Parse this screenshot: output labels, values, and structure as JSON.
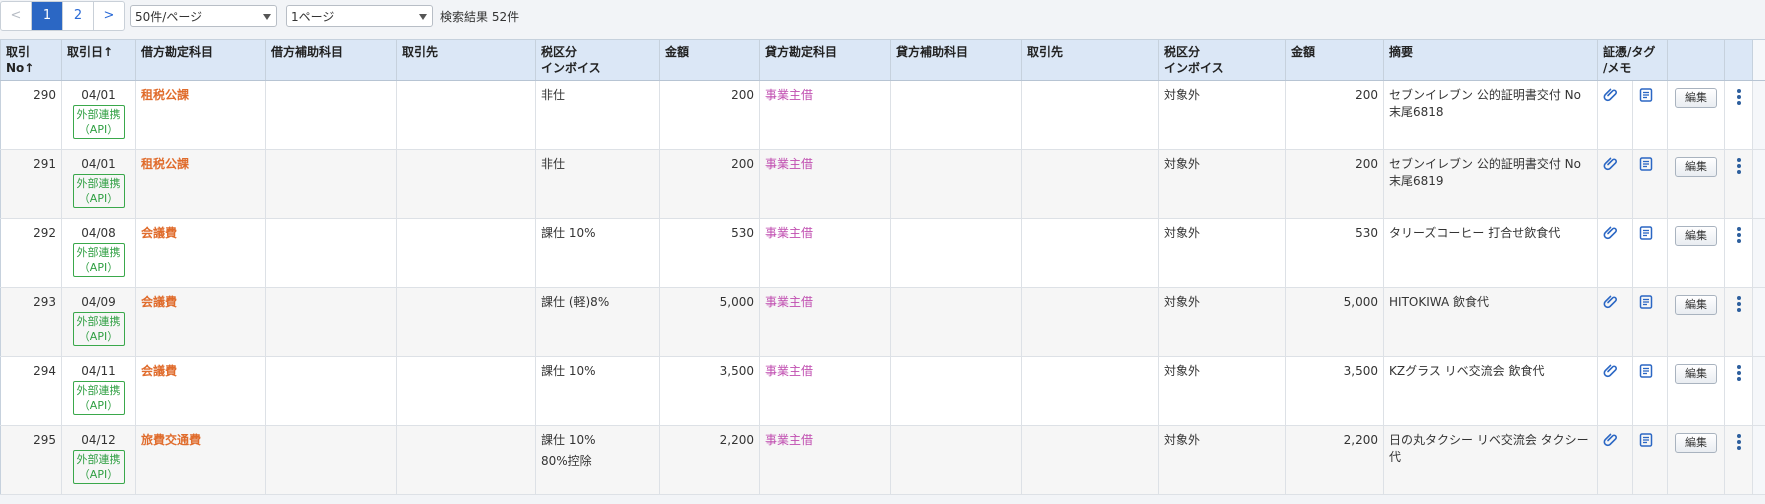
{
  "pagination": {
    "prev": "<",
    "pages": [
      "1",
      "2"
    ],
    "active_page": "1",
    "next": ">",
    "per_page": "50件/ページ",
    "page_select": "1ページ",
    "result_count": "検索結果 52件"
  },
  "headers": {
    "txn_no": "取引No↑",
    "txn_date": "取引日↑",
    "debit_account": "借方勘定科目",
    "debit_sub": "借方補助科目",
    "debit_partner": "取引先",
    "debit_tax_1": "税区分",
    "debit_tax_2": "インボイス",
    "debit_amount": "金額",
    "credit_account": "貸方勘定科目",
    "credit_sub": "貸方補助科目",
    "credit_partner": "取引先",
    "credit_tax_1": "税区分",
    "credit_tax_2": "インボイス",
    "credit_amount": "金額",
    "summary": "摘要",
    "evidence_1": "証憑/タグ",
    "evidence_2": "/メモ"
  },
  "edit_label": "編集",
  "api_tag_line1": "外部連携",
  "api_tag_line2": "（API）",
  "rows": [
    {
      "no": "290",
      "date": "04/01",
      "debit_account": "租税公課",
      "debit_tax": "非仕",
      "debit_tax_note": "",
      "debit_amount": "200",
      "credit_account": "事業主借",
      "credit_tax": "対象外",
      "credit_amount": "200",
      "summary": "セブンイレブン 公的証明書交付 No末尾6818"
    },
    {
      "no": "291",
      "date": "04/01",
      "debit_account": "租税公課",
      "debit_tax": "非仕",
      "debit_tax_note": "",
      "debit_amount": "200",
      "credit_account": "事業主借",
      "credit_tax": "対象外",
      "credit_amount": "200",
      "summary": "セブンイレブン 公的証明書交付 No末尾6819"
    },
    {
      "no": "292",
      "date": "04/08",
      "debit_account": "会議費",
      "debit_tax": "課仕 10%",
      "debit_tax_note": "",
      "debit_amount": "530",
      "credit_account": "事業主借",
      "credit_tax": "対象外",
      "credit_amount": "530",
      "summary": "タリーズコーヒー 打合せ飲食代"
    },
    {
      "no": "293",
      "date": "04/09",
      "debit_account": "会議費",
      "debit_tax": "課仕 (軽)8%",
      "debit_tax_note": "",
      "debit_amount": "5,000",
      "credit_account": "事業主借",
      "credit_tax": "対象外",
      "credit_amount": "5,000",
      "summary": "HITOKIWA 飲食代"
    },
    {
      "no": "294",
      "date": "04/11",
      "debit_account": "会議費",
      "debit_tax": "課仕 10%",
      "debit_tax_note": "",
      "debit_amount": "3,500",
      "credit_account": "事業主借",
      "credit_tax": "対象外",
      "credit_amount": "3,500",
      "summary": "KZグラス リベ交流会 飲食代"
    },
    {
      "no": "295",
      "date": "04/12",
      "debit_account": "旅費交通費",
      "debit_tax": "課仕 10%",
      "debit_tax_note": "80%控除",
      "debit_amount": "2,200",
      "credit_account": "事業主借",
      "credit_tax": "対象外",
      "credit_amount": "2,200",
      "summary": "日の丸タクシー リベ交流会 タクシー代"
    }
  ],
  "colors": {
    "active_page": "#2b67c4",
    "debit_account": "#e06c2c",
    "credit_account": "#c04db0",
    "api_tag": "#2f9f42",
    "header_bg": "#dbe7f6"
  },
  "icons": [
    "paperclip-icon",
    "memo-icon",
    "kebab-menu-icon"
  ]
}
